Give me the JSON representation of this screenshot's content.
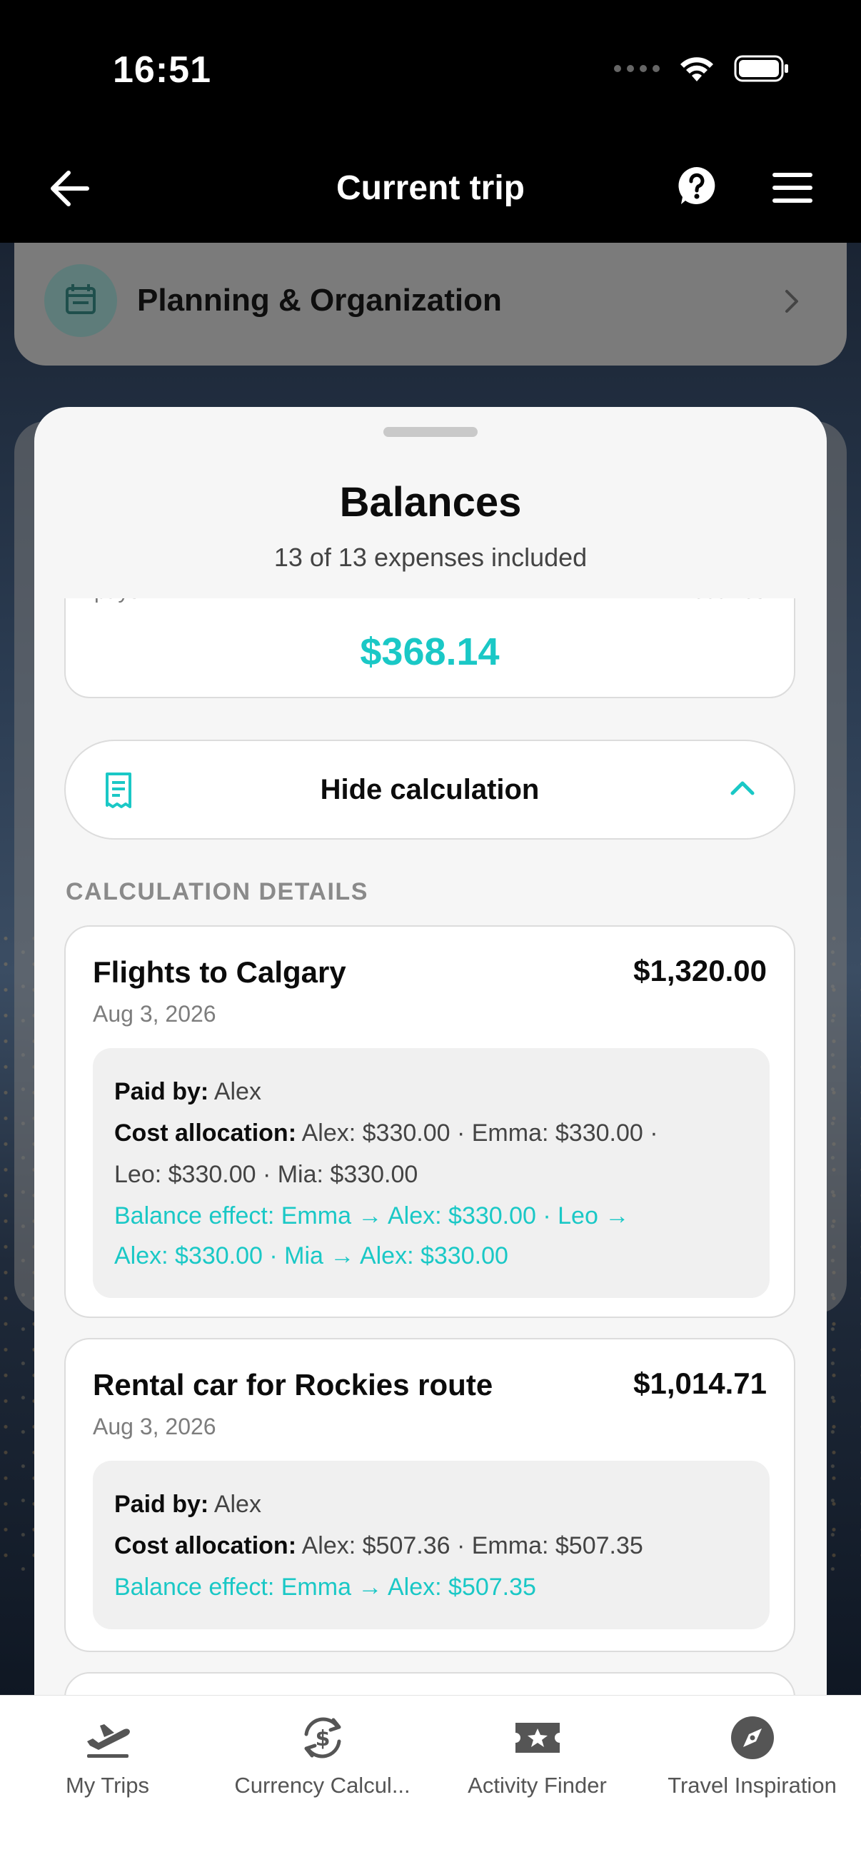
{
  "status_bar": {
    "time": "16:51"
  },
  "header": {
    "title": "Current trip"
  },
  "background": {
    "planning_label": "Planning & Organization"
  },
  "sheet": {
    "title": "Balances",
    "subtitle": "13 of 13 expenses included",
    "result": {
      "pays_label": "pays",
      "receives_label": "receives",
      "amount": "$368.14"
    },
    "toggle_label": "Hide calculation",
    "section_heading": "CALCULATION DETAILS",
    "expenses": [
      {
        "title": "Flights to Calgary",
        "amount": "$1,320.00",
        "date": "Aug 3, 2026",
        "paid_by_label": "Paid by:",
        "paid_by": "Alex",
        "allocation_label": "Cost allocation:",
        "allocation_line1": "Alex: $330.00 · Emma: $330.00 ·",
        "allocation_line2": "Leo: $330.00 · Mia: $330.00",
        "effect_line1": "Balance effect: Emma → Alex: $330.00 · Leo →",
        "effect_line2": "Alex: $330.00 · Mia → Alex: $330.00"
      },
      {
        "title": "Rental car for Rockies route",
        "amount": "$1,014.71",
        "date": "Aug 3, 2026",
        "paid_by_label": "Paid by:",
        "paid_by": "Alex",
        "allocation_label": "Cost allocation:",
        "allocation_line1": "Alex: $507.36 · Emma: $507.35",
        "effect_line1": "Balance effect: Emma → Alex: $507.35"
      }
    ]
  },
  "tabs": [
    {
      "label": "My Trips",
      "icon": "plane-departure-icon"
    },
    {
      "label": "Currency Calcul...",
      "icon": "currency-exchange-icon"
    },
    {
      "label": "Activity Finder",
      "icon": "ticket-star-icon"
    },
    {
      "label": "Travel Inspiration",
      "icon": "compass-icon"
    }
  ],
  "colors": {
    "accent": "#1ac8c6",
    "nav_background": "#000000",
    "sheet_background": "#f6f6f6"
  }
}
